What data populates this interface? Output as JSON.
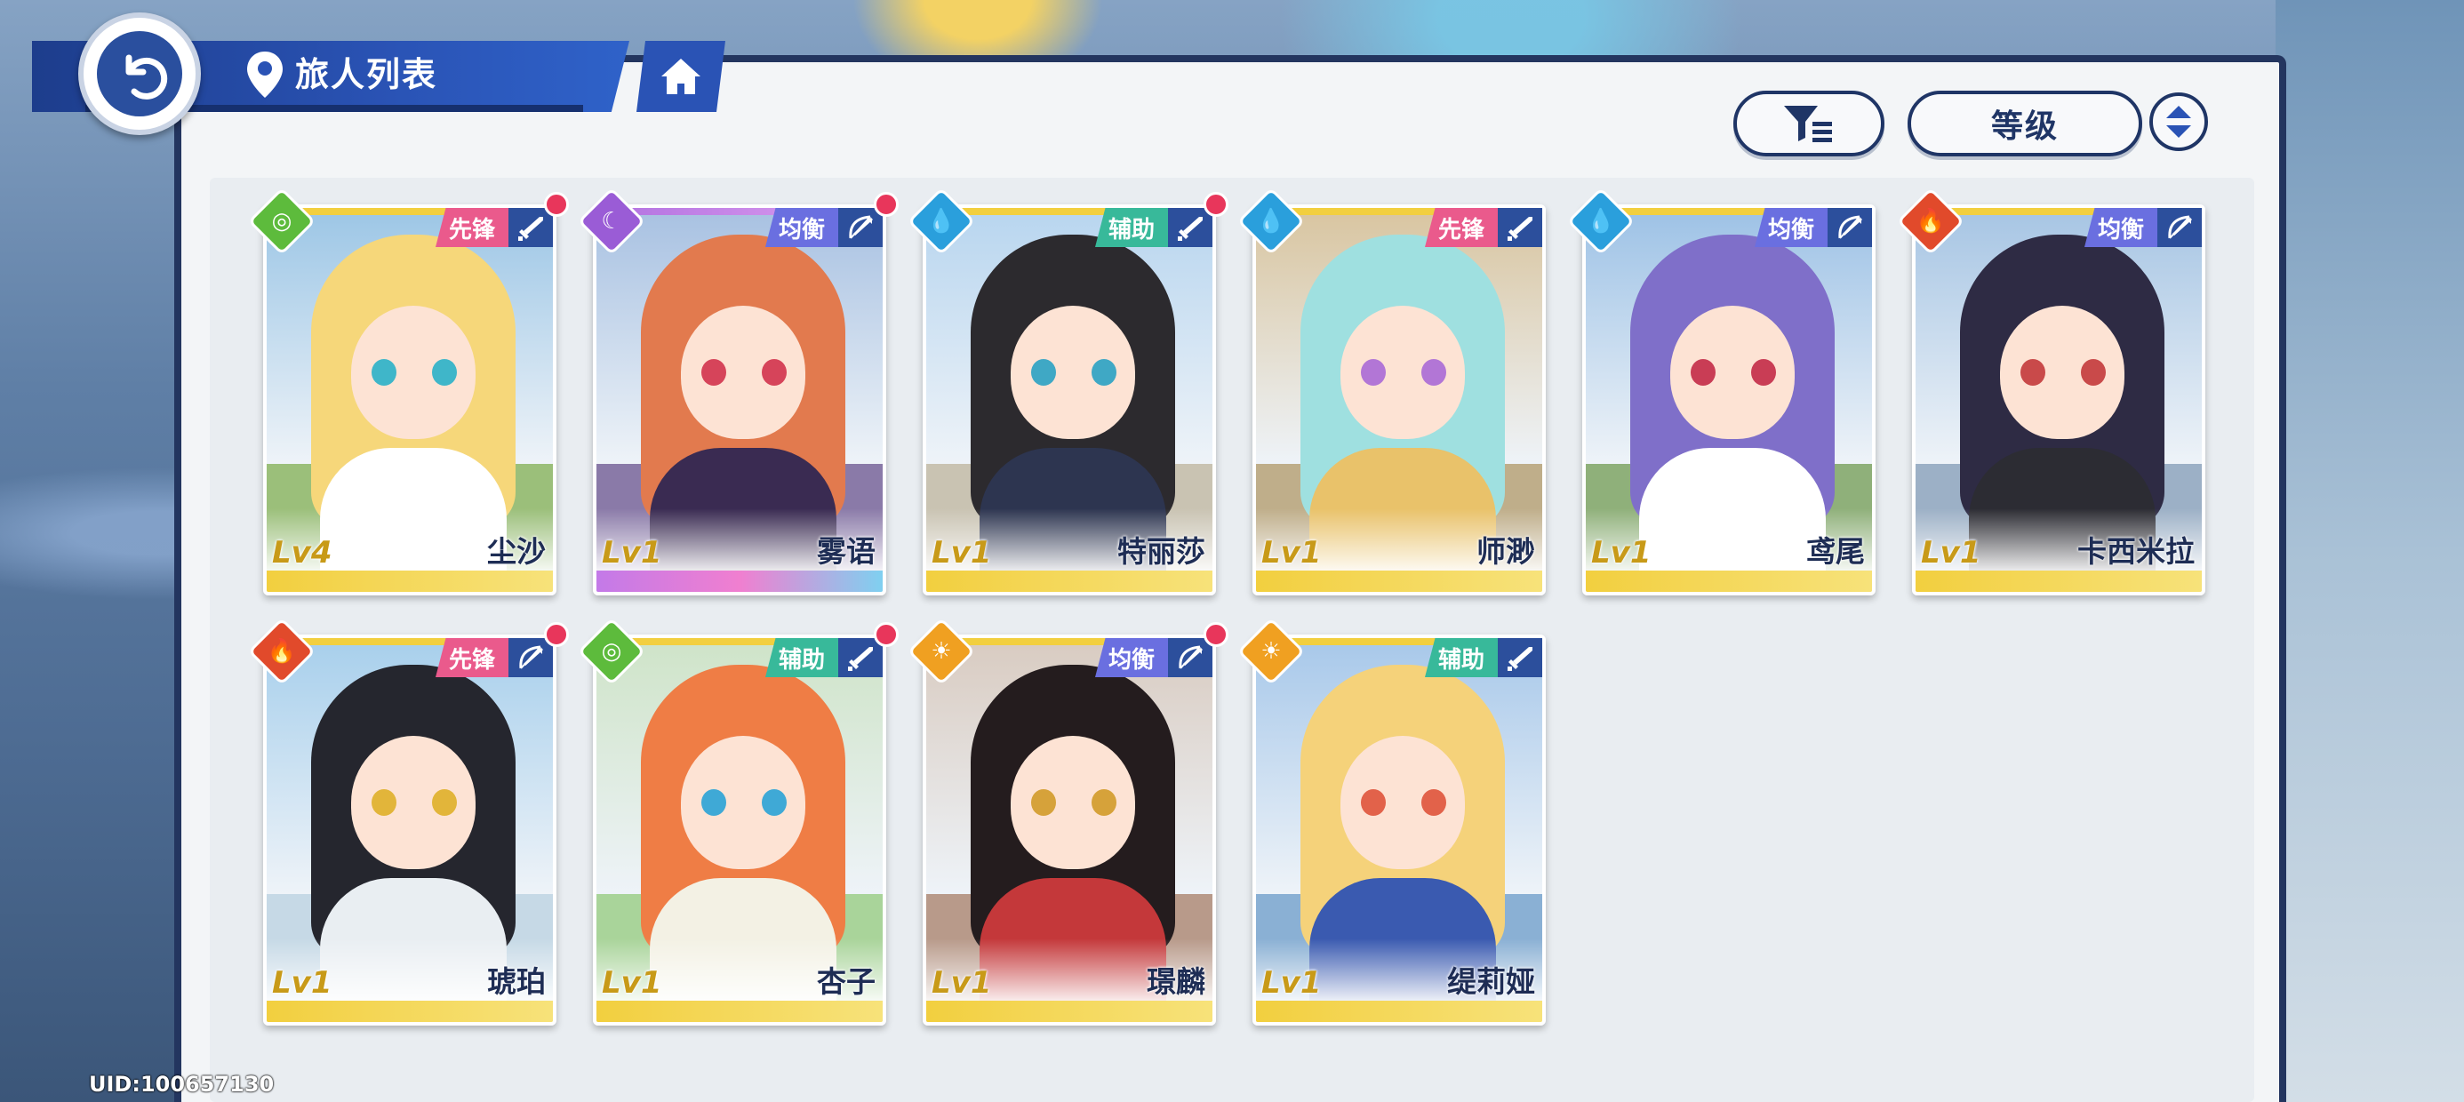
{
  "header": {
    "title": "旅人列表",
    "back_icon": "back-arrow-icon",
    "location_icon": "map-pin-icon",
    "home_icon": "home-icon"
  },
  "controls": {
    "filter_icon": "filter-icon",
    "sort_label": "等级",
    "order_icon": "sort-order-icon"
  },
  "colors": {
    "role_vanguard": "#ea5a8c",
    "role_balanced": "#6a6fe0",
    "role_support": "#38b99a",
    "weapon_bg": "#2c4f9c",
    "elem_wind": "#5dbb3c",
    "elem_moon": "#9a5cd6",
    "elem_water": "#2a9fdc",
    "elem_fire": "#e14a2b",
    "elem_light": "#f0a021",
    "level_gold": "#c89a18",
    "notify_dot": "#e8365b"
  },
  "characters": [
    {
      "name": "尘沙",
      "level": "Lv4",
      "element": "wind",
      "role": "先锋",
      "weapon": "sword-icon",
      "badge": true
    },
    {
      "name": "雾语",
      "level": "Lv1",
      "element": "moon",
      "role": "均衡",
      "weapon": "bow-icon",
      "badge": true
    },
    {
      "name": "特丽莎",
      "level": "Lv1",
      "element": "water",
      "role": "辅助",
      "weapon": "sword-icon",
      "badge": true
    },
    {
      "name": "师渺",
      "level": "Lv1",
      "element": "water",
      "role": "先锋",
      "weapon": "sword-icon",
      "badge": false
    },
    {
      "name": "鸢尾",
      "level": "Lv1",
      "element": "water",
      "role": "均衡",
      "weapon": "bow-icon",
      "badge": false
    },
    {
      "name": "卡西米拉",
      "level": "Lv1",
      "element": "fire",
      "role": "均衡",
      "weapon": "bow-icon",
      "badge": false
    },
    {
      "name": "琥珀",
      "level": "Lv1",
      "element": "fire",
      "role": "先锋",
      "weapon": "bow-icon",
      "badge": true
    },
    {
      "name": "杏子",
      "level": "Lv1",
      "element": "wind",
      "role": "辅助",
      "weapon": "sword-icon",
      "badge": true
    },
    {
      "name": "璟麟",
      "level": "Lv1",
      "element": "light",
      "role": "均衡",
      "weapon": "bow-icon",
      "badge": true
    },
    {
      "name": "缇莉娅",
      "level": "Lv1",
      "element": "light",
      "role": "辅助",
      "weapon": "sword-icon",
      "badge": false
    }
  ],
  "footer": {
    "uid": "UID:100657130"
  }
}
